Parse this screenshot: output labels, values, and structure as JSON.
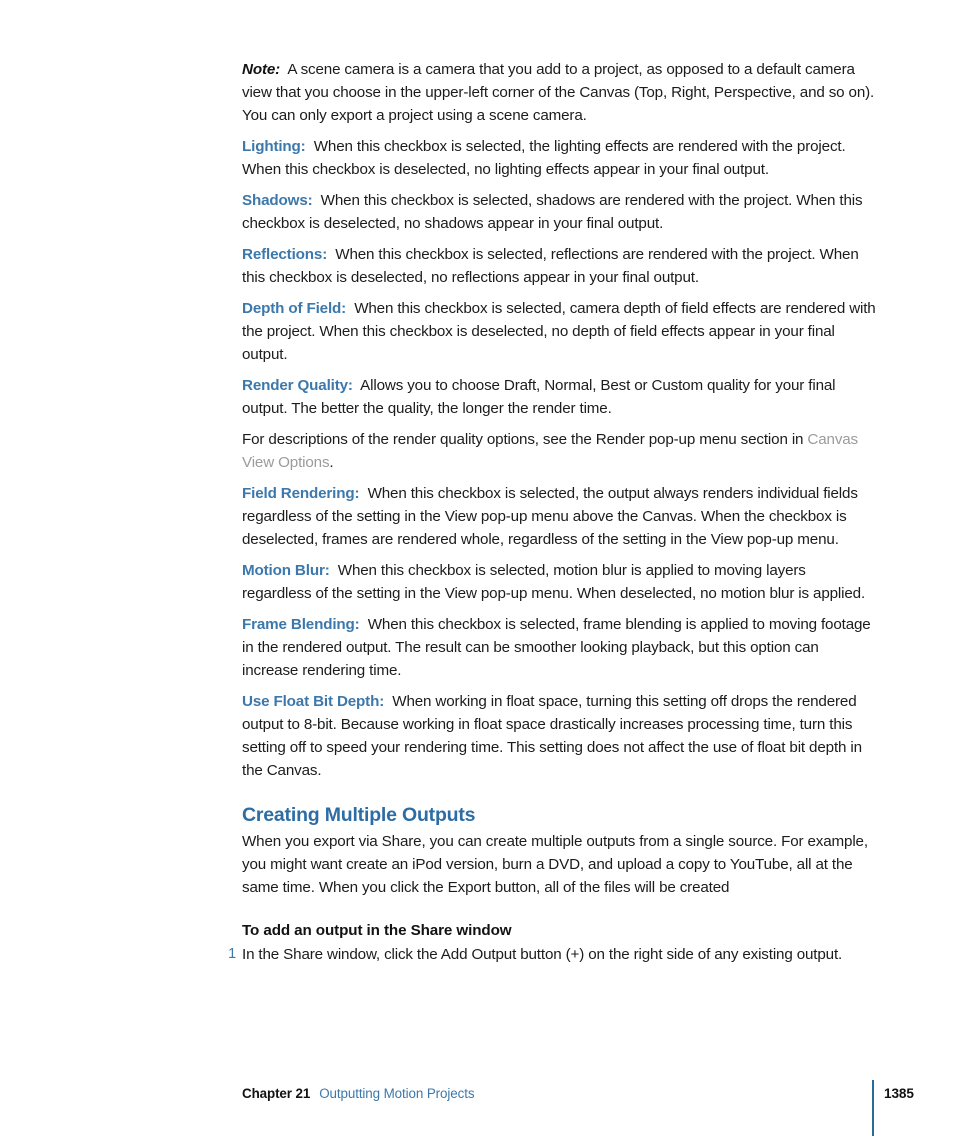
{
  "document": {
    "body_paragraphs": [
      {
        "lead": "Note:",
        "lead_style": "note",
        "text": "A scene camera is a camera that you add to a project, as opposed to a default camera view that you choose in the upper-left corner of the Canvas (Top, Right, Perspective, and so on). You can only export a project using a scene camera."
      },
      {
        "lead": "Lighting:",
        "lead_style": "blue",
        "text": "When this checkbox is selected, the lighting effects are rendered with the project. When this checkbox is deselected, no lighting effects appear in your final output."
      },
      {
        "lead": "Shadows:",
        "lead_style": "blue",
        "text": "When this checkbox is selected, shadows are rendered with the project. When this checkbox is deselected, no shadows appear in your final output."
      },
      {
        "lead": "Reflections:",
        "lead_style": "blue",
        "text": "When this checkbox is selected, reflections are rendered with the project. When this checkbox is deselected, no reflections appear in your final output."
      },
      {
        "lead": "Depth of Field:",
        "lead_style": "blue",
        "text": "When this checkbox is selected, camera depth of field effects are rendered with the project. When this checkbox is deselected, no depth of field effects appear in your final output."
      },
      {
        "lead": "Render Quality:",
        "lead_style": "blue",
        "text": "Allows you to choose Draft, Normal, Best or Custom quality for your final output. The better the quality, the longer the render time."
      }
    ],
    "cross_reference_paragraph": {
      "text_before": "For descriptions of the render quality options, see the Render pop-up menu section in ",
      "link_text": "Canvas View Options",
      "text_after": "."
    },
    "body_paragraphs_2": [
      {
        "lead": "Field Rendering:",
        "lead_style": "blue",
        "text": "When this checkbox is selected, the output always renders individual fields regardless of the setting in the View pop-up menu above the Canvas. When the checkbox is deselected, frames are rendered whole, regardless of the setting in the View pop-up menu."
      },
      {
        "lead": "Motion Blur:",
        "lead_style": "blue",
        "text": "When this checkbox is selected, motion blur is applied to moving layers regardless of the setting in the View pop-up menu. When deselected, no motion blur is applied."
      },
      {
        "lead": "Frame Blending:",
        "lead_style": "blue",
        "text": "When this checkbox is selected, frame blending is applied to moving footage in the rendered output. The result can be smoother looking playback, but this option can increase rendering time."
      },
      {
        "lead": "Use Float Bit Depth:",
        "lead_style": "blue",
        "text": "When working in float space, turning this setting off drops the rendered output to 8-bit. Because working in float space drastically increases processing time, turn this setting off to speed your rendering time. This setting does not affect the use of float bit depth in the Canvas."
      }
    ],
    "section": {
      "heading": "Creating Multiple Outputs",
      "intro": "When you export via Share, you can create multiple outputs from a single source. For example, you might want create an iPod version, burn a DVD, and upload a copy to YouTube, all at the same time. When you click the Export button, all of the files will be created"
    },
    "task": {
      "heading": "To add an output in the Share window",
      "steps": [
        {
          "number": "1",
          "text": "In the Share window, click the Add Output button (+) on the right side of any existing output."
        }
      ]
    },
    "footer": {
      "chapter_label": "Chapter 21",
      "chapter_title": "Outputting Motion Projects",
      "page_number": "1385"
    },
    "colors": {
      "lead_blue": "#3c78ab",
      "heading_blue": "#2e6da4",
      "rule_blue": "#2b6a96",
      "grey_link": "#9b9b9b",
      "body_text": "#1c1c1c"
    }
  }
}
